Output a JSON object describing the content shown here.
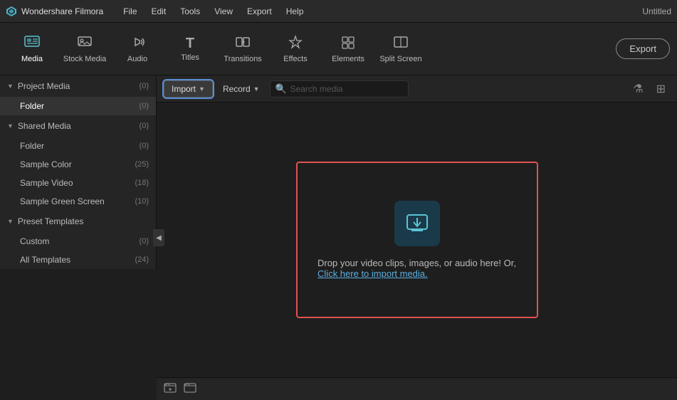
{
  "app": {
    "name": "Wondershare Filmora",
    "logo": "◈",
    "window_title": "Untitled"
  },
  "menu": {
    "items": [
      "File",
      "Edit",
      "Tools",
      "View",
      "Export",
      "Help"
    ]
  },
  "toolbar": {
    "items": [
      {
        "id": "media",
        "label": "Media",
        "icon": "☰",
        "active": true
      },
      {
        "id": "stock-media",
        "label": "Stock Media",
        "icon": "⊞"
      },
      {
        "id": "audio",
        "label": "Audio",
        "icon": "♪"
      },
      {
        "id": "titles",
        "label": "Titles",
        "icon": "T"
      },
      {
        "id": "transitions",
        "label": "Transitions",
        "icon": "↔"
      },
      {
        "id": "effects",
        "label": "Effects",
        "icon": "✦"
      },
      {
        "id": "elements",
        "label": "Elements",
        "icon": "❋"
      },
      {
        "id": "split-screen",
        "label": "Split Screen",
        "icon": "⊟"
      }
    ],
    "export_label": "Export"
  },
  "sidebar": {
    "sections": [
      {
        "id": "project-media",
        "label": "Project Media",
        "count": "(0)",
        "expanded": true,
        "items": [
          {
            "id": "folder",
            "label": "Folder",
            "count": "(0)",
            "active": true
          }
        ]
      },
      {
        "id": "shared-media",
        "label": "Shared Media",
        "count": "(0)",
        "expanded": true,
        "items": [
          {
            "id": "folder2",
            "label": "Folder",
            "count": "(0)"
          },
          {
            "id": "sample-color",
            "label": "Sample Color",
            "count": "(25)"
          },
          {
            "id": "sample-video",
            "label": "Sample Video",
            "count": "(18)"
          },
          {
            "id": "sample-green-screen",
            "label": "Sample Green Screen",
            "count": "(10)"
          }
        ]
      },
      {
        "id": "preset-templates",
        "label": "Preset Templates",
        "count": "",
        "expanded": true,
        "items": [
          {
            "id": "custom",
            "label": "Custom",
            "count": "(0)"
          },
          {
            "id": "all-templates",
            "label": "All Templates",
            "count": "(24)"
          }
        ]
      }
    ]
  },
  "content_toolbar": {
    "import_label": "Import",
    "record_label": "Record",
    "search_placeholder": "Search media"
  },
  "drop_zone": {
    "text": "Drop your video clips, images, or audio here! Or,",
    "link_text": "Click here to import media."
  },
  "bottom": {
    "add_icon": "＋",
    "folder_icon": "📁"
  }
}
